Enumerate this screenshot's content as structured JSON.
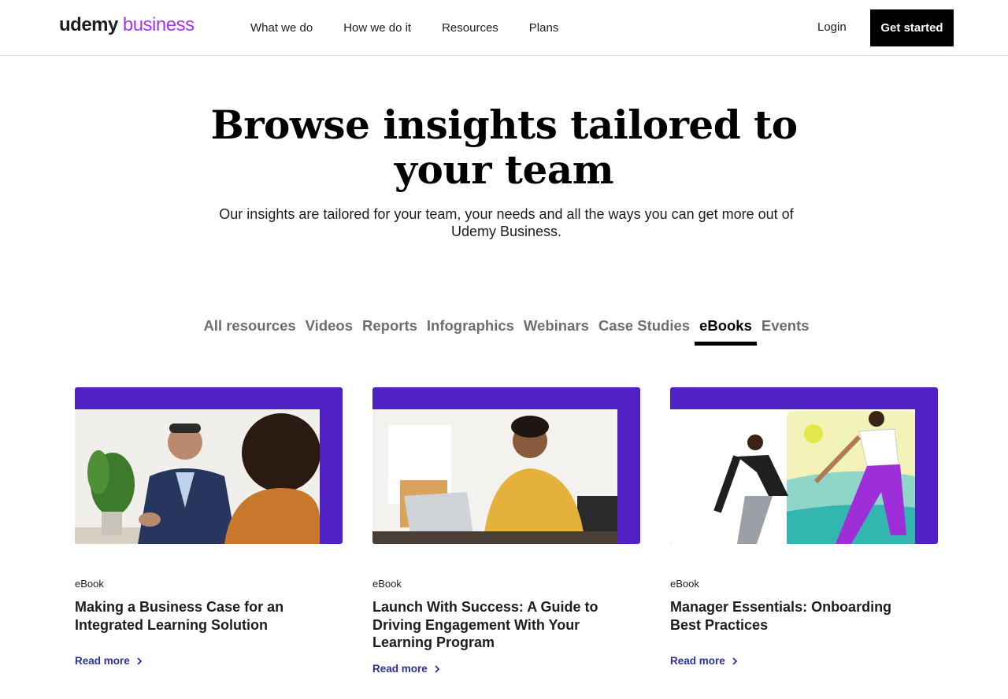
{
  "header": {
    "logo_primary": "udemy",
    "logo_secondary": "business",
    "nav": [
      "What we do",
      "How we do it",
      "Resources",
      "Plans"
    ],
    "login": "Login",
    "cta": "Get started"
  },
  "hero": {
    "title": "Browse insights tailored to your team",
    "subtitle": "Our insights are tailored for your team, your needs and all the ways you can get more out of Udemy Business."
  },
  "tabs": {
    "items": [
      "All resources",
      "Videos",
      "Reports",
      "Infographics",
      "Webinars",
      "Case Studies",
      "eBooks",
      "Events"
    ],
    "active": "eBooks"
  },
  "cards": [
    {
      "kind": "eBook",
      "title": "Making a Business Case for an Integrated Learning Solution",
      "cta": "Read more"
    },
    {
      "kind": "eBook",
      "title": "Launch With Success: A Guide to Driving Engagement With Your Learning Program",
      "cta": "Read more"
    },
    {
      "kind": "eBook",
      "title": "Manager Essentials: Onboarding Best Practices",
      "cta": "Read more"
    }
  ],
  "colors": {
    "brand_purple": "#a435f0",
    "card_frame": "#5022c3",
    "link_blue": "#2d2f9e",
    "cta_bg": "#000000"
  }
}
